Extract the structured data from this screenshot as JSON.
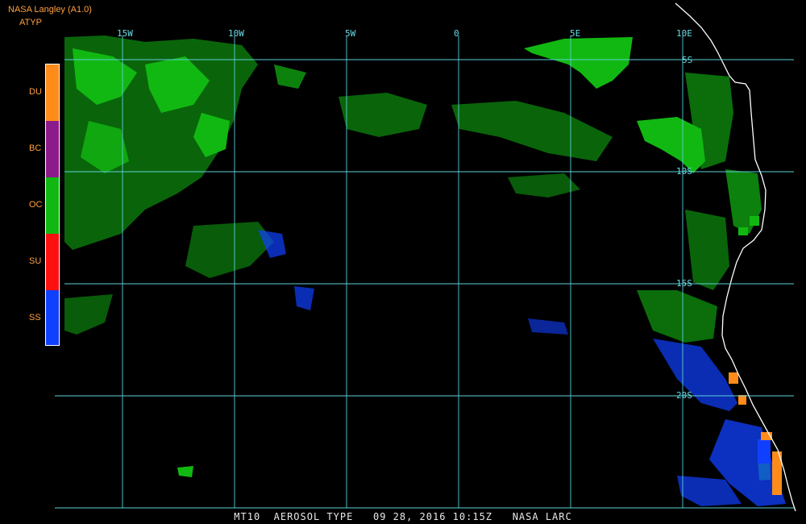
{
  "header": {
    "agency": "NASA Langley (A1.0)",
    "product": "ATYP"
  },
  "legend": {
    "items": [
      {
        "code": "DU",
        "color": "#ff8c1a"
      },
      {
        "code": "BC",
        "color": "#8b1a8b"
      },
      {
        "code": "OC",
        "color": "#12b812"
      },
      {
        "code": "SU",
        "color": "#ff1010"
      },
      {
        "code": "SS",
        "color": "#1040ff"
      }
    ]
  },
  "grid": {
    "longitude_labels": [
      "15W",
      "10W",
      "5W",
      "0",
      "5E",
      "10E"
    ],
    "latitude_labels": [
      "5S",
      "10S",
      "15S",
      "20S"
    ],
    "line_color": "#5ccfd8"
  },
  "footer": {
    "caption": "MT10  AEROSOL TYPE   09 28, 2016 10:15Z   NASA LARC"
  },
  "colors": {
    "background": "#000000",
    "coastline": "#ffffff",
    "oc": "#12b812",
    "ss": "#1040ff",
    "du": "#ff8c1a"
  }
}
